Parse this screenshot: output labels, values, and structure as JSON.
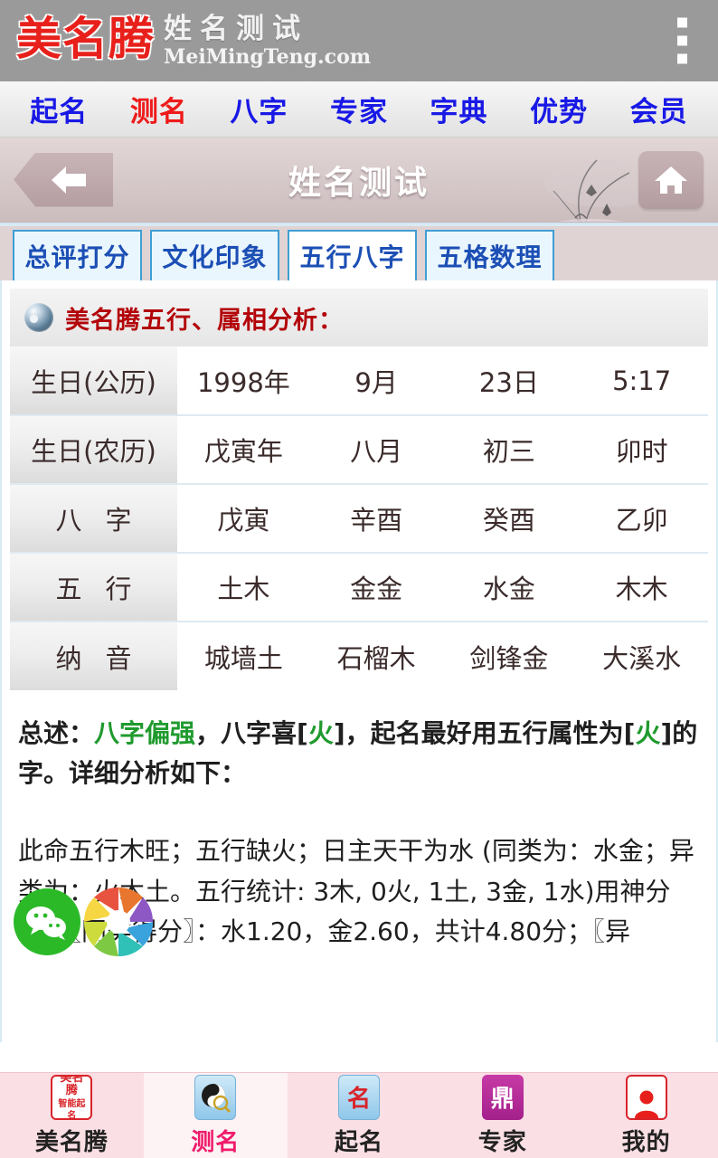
{
  "header": {
    "logo_main": "美名腾",
    "logo_sub_cn": "姓名测试",
    "logo_sub_en": "MeiMingTeng.com",
    "menu_icon": "kebab-menu-icon",
    "bg_color": "#9a9a9a"
  },
  "nav": {
    "items": [
      {
        "label": "起名",
        "active": false
      },
      {
        "label": "测名",
        "active": true
      },
      {
        "label": "八字",
        "active": false
      },
      {
        "label": "专家",
        "active": false
      },
      {
        "label": "字典",
        "active": false
      },
      {
        "label": "优势",
        "active": false
      },
      {
        "label": "会员",
        "active": false
      }
    ],
    "link_color": "#1919e6",
    "active_color": "#ef1b1b"
  },
  "titlebar": {
    "title": "姓名测试",
    "back_icon": "back-arrow-icon",
    "home_icon": "home-icon",
    "decoration": "ink-orchid-painting"
  },
  "tabs": [
    {
      "label": "总评打分",
      "active": false
    },
    {
      "label": "文化印象",
      "active": false
    },
    {
      "label": "五行八字",
      "active": true
    },
    {
      "label": "五格数理",
      "active": false
    }
  ],
  "section": {
    "icon": "yinyang-globe-icon",
    "title": "美名腾五行、属相分析："
  },
  "table": {
    "rows": [
      {
        "label": "生日(公历)",
        "spaced": false,
        "cells": [
          "1998年",
          "9月",
          "23日",
          "5:17"
        ]
      },
      {
        "label": "生日(农历)",
        "spaced": false,
        "cells": [
          "戊寅年",
          "八月",
          "初三",
          "卯时"
        ]
      },
      {
        "label": "八字",
        "spaced": true,
        "cells": [
          "戊寅",
          "辛酉",
          "癸酉",
          "乙卯"
        ]
      },
      {
        "label": "五行",
        "spaced": true,
        "cells": [
          "土木",
          "金金",
          "水金",
          "木木"
        ]
      },
      {
        "label": "纳音",
        "spaced": true,
        "cells": [
          "城墙土",
          "石榴木",
          "剑锋金",
          "大溪水"
        ]
      }
    ]
  },
  "summary": {
    "label": "总述：",
    "highlight1": "八字偏强",
    "mid1": "，八字喜[",
    "highlight2": "火",
    "mid2": "]，起名最好用五行属性为[",
    "highlight3": "火",
    "mid3": "]的字。详细分析如下：",
    "highlight_color": "#1f9a2e"
  },
  "detail": {
    "line": "此命五行木旺；五行缺火；日主天干为水 (同类为：水金；异类为：火木土。五行统计: 3木, 0火, 1土, 3金, 1水)用神分析：〖同类得分〗：水1.20，金2.60，共计4.80分；〖异"
  },
  "float_icons": [
    {
      "name": "wechat-share-icon",
      "color": "#2bb928"
    },
    {
      "name": "aperture-share-icon",
      "color": "multicolor"
    }
  ],
  "bottom_nav": [
    {
      "label": "美名腾",
      "icon": "meimingteng-logo-icon",
      "icon_text": "美名腾",
      "icon_sub": "智能起名",
      "active": false
    },
    {
      "label": "测名",
      "icon": "yinyang-magnifier-icon",
      "icon_text": "",
      "icon_sub": "",
      "active": true
    },
    {
      "label": "起名",
      "icon": "name-brush-icon",
      "icon_text": "名",
      "icon_sub": "",
      "active": false
    },
    {
      "label": "专家",
      "icon": "expert-seal-icon",
      "icon_text": "鼎",
      "icon_sub": "",
      "active": false
    },
    {
      "label": "我的",
      "icon": "user-profile-icon",
      "icon_text": "",
      "icon_sub": "",
      "active": false
    }
  ]
}
